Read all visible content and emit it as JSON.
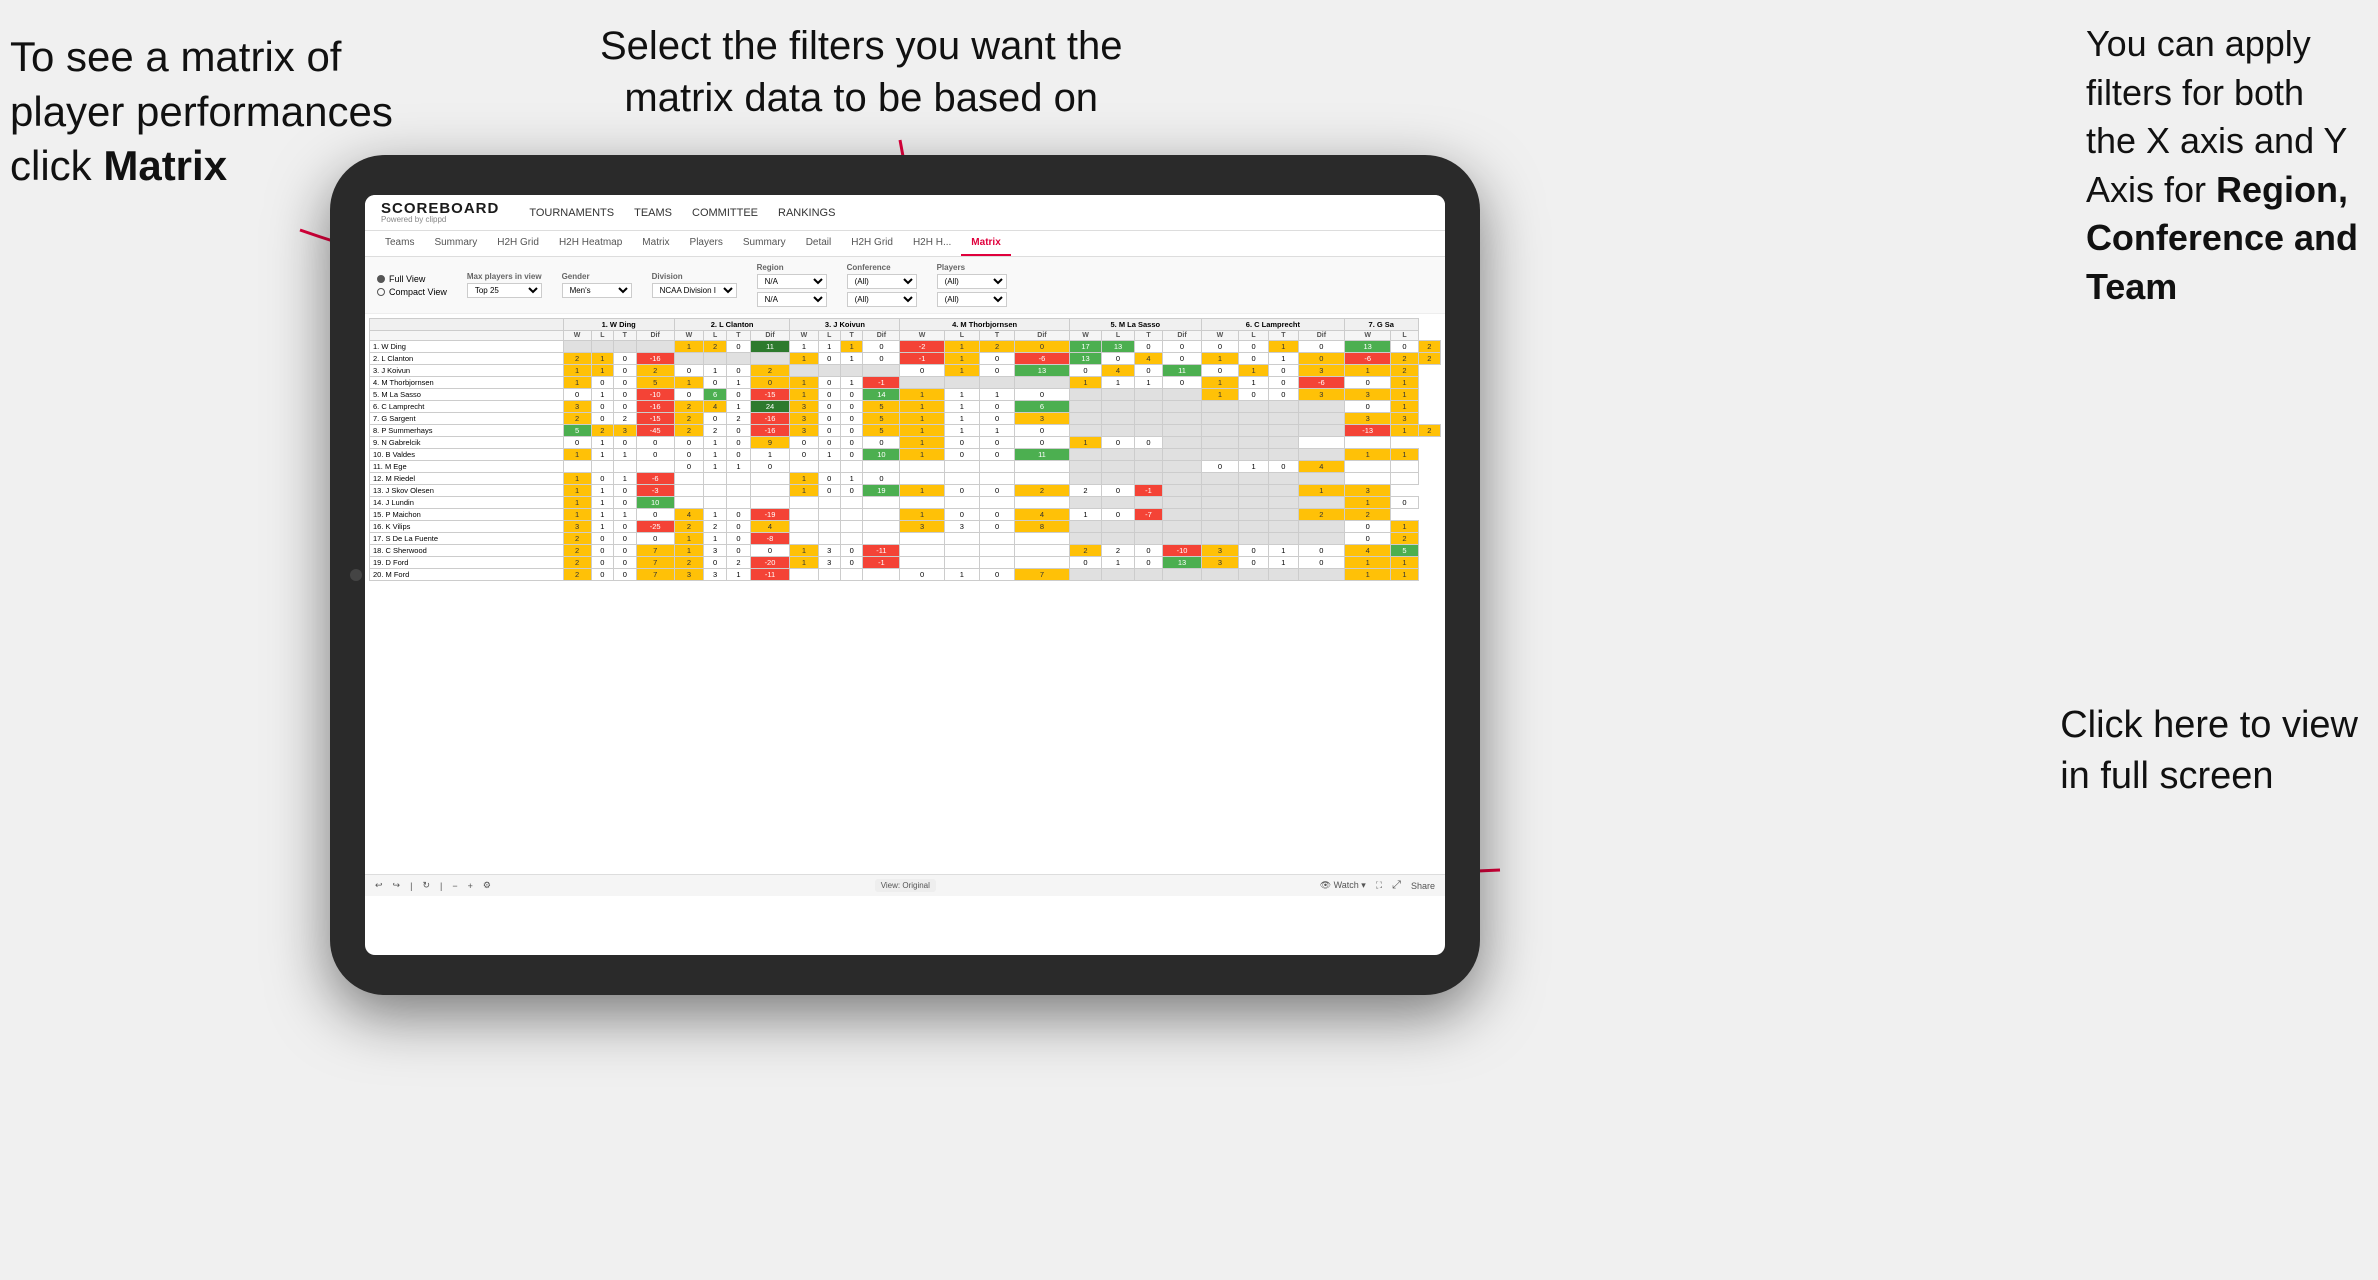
{
  "annotations": {
    "top_left": {
      "line1": "To see a matrix of",
      "line2": "player performances",
      "line3_prefix": "click ",
      "line3_bold": "Matrix"
    },
    "top_center": {
      "line1": "Select the filters you want the",
      "line2": "matrix data to be based on"
    },
    "top_right": {
      "line1": "You  can apply",
      "line2": "filters for both",
      "line3": "the X axis and Y",
      "line4_prefix": "Axis for ",
      "line4_bold": "Region,",
      "line5_bold": "Conference and",
      "line6_bold": "Team"
    },
    "bottom_right": {
      "line1": "Click here to view",
      "line2": "in full screen"
    }
  },
  "app": {
    "logo_main": "SCOREBOARD",
    "logo_sub": "Powered by clippd",
    "nav": [
      "TOURNAMENTS",
      "TEAMS",
      "COMMITTEE",
      "RANKINGS"
    ],
    "tabs": [
      "Teams",
      "Summary",
      "H2H Grid",
      "H2H Heatmap",
      "Matrix",
      "Players",
      "Summary",
      "Detail",
      "H2H Grid",
      "H2H H...",
      "Matrix"
    ],
    "active_tab": "Matrix"
  },
  "filters": {
    "view_options": [
      "Full View",
      "Compact View"
    ],
    "selected_view": "Full View",
    "max_players_label": "Max players in view",
    "max_players_value": "Top 25",
    "gender_label": "Gender",
    "gender_value": "Men's",
    "division_label": "Division",
    "division_value": "NCAA Division I",
    "region_label": "Region",
    "region_value": "N/A",
    "conference_label": "Conference",
    "conference_values": [
      "(All)",
      "(All)"
    ],
    "players_label": "Players",
    "players_values": [
      "(All)",
      "(All)"
    ]
  },
  "matrix": {
    "col_headers": [
      "1. W Ding",
      "2. L Clanton",
      "3. J Koivun",
      "4. M Thorbjornsen",
      "5. M La Sasso",
      "6. C Lamprecht",
      "7. G Sa"
    ],
    "sub_headers": [
      "W",
      "L",
      "T",
      "Dif"
    ],
    "rows": [
      {
        "name": "1. W Ding",
        "cells": []
      },
      {
        "name": "2. L Clanton",
        "cells": []
      },
      {
        "name": "3. J Koivun",
        "cells": []
      },
      {
        "name": "4. M Thorbjornsen",
        "cells": []
      },
      {
        "name": "5. M La Sasso",
        "cells": []
      },
      {
        "name": "6. C Lamprecht",
        "cells": []
      },
      {
        "name": "7. G Sargent",
        "cells": []
      },
      {
        "name": "8. P Summerhays",
        "cells": []
      },
      {
        "name": "9. N Gabrelcik",
        "cells": []
      },
      {
        "name": "10. B Valdes",
        "cells": []
      },
      {
        "name": "11. M Ege",
        "cells": []
      },
      {
        "name": "12. M Riedel",
        "cells": []
      },
      {
        "name": "13. J Skov Olesen",
        "cells": []
      },
      {
        "name": "14. J Lundin",
        "cells": []
      },
      {
        "name": "15. P Maichon",
        "cells": []
      },
      {
        "name": "16. K Vilips",
        "cells": []
      },
      {
        "name": "17. S De La Fuente",
        "cells": []
      },
      {
        "name": "18. C Sherwood",
        "cells": []
      },
      {
        "name": "19. D Ford",
        "cells": []
      },
      {
        "name": "20. M Ford",
        "cells": []
      }
    ]
  },
  "footer": {
    "view_label": "View: Original",
    "watch_label": "Watch",
    "share_label": "Share"
  },
  "colors": {
    "accent": "#e0003c",
    "green_dark": "#2d7a2d",
    "green": "#4caf50",
    "yellow": "#ffc107",
    "orange": "#ff9800"
  }
}
